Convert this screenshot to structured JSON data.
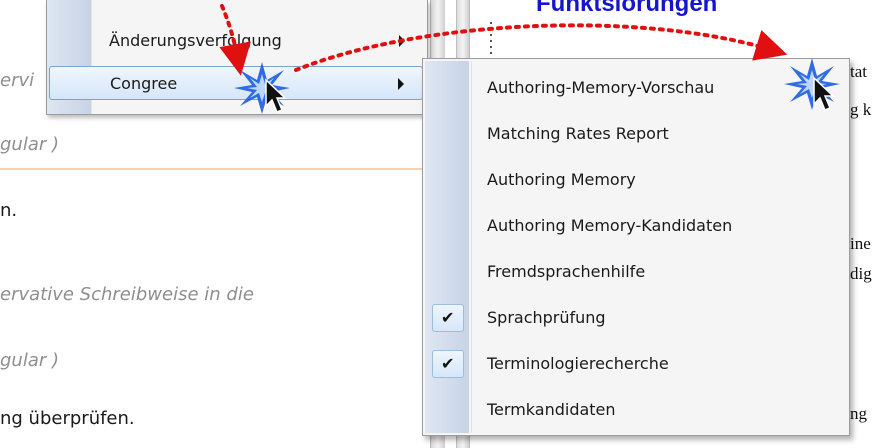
{
  "background_left": {
    "lines": [
      {
        "text": "ervi",
        "italic": true
      },
      {
        "text": "gular )",
        "italic": true
      },
      {
        "text": "n.",
        "italic": false
      },
      {
        "text": "ervative Schreibweise in die",
        "italic": true
      },
      {
        "text": "gular )",
        "italic": true
      },
      {
        "text": "ng überprüfen.",
        "italic": false
      }
    ]
  },
  "background_right": {
    "title": "Funktsiorungen",
    "fragments": [
      "tat",
      "g k",
      "ine",
      "dig",
      "ng"
    ]
  },
  "context_menu": {
    "items": [
      {
        "label": "Änderungsverfolgung",
        "has_submenu": true,
        "highlighted": false
      },
      {
        "label": "Congree",
        "has_submenu": true,
        "highlighted": true
      }
    ]
  },
  "submenu": {
    "items": [
      {
        "label": "Authoring-Memory-Vorschau",
        "checked": false
      },
      {
        "label": "Matching Rates Report",
        "checked": false
      },
      {
        "label": "Authoring Memory",
        "checked": false
      },
      {
        "label": "Authoring Memory-Kandidaten",
        "checked": false
      },
      {
        "label": "Fremdsprachenhilfe",
        "checked": false
      },
      {
        "label": "Sprachprüfung",
        "checked": true
      },
      {
        "label": "Terminologierecherche",
        "checked": true
      },
      {
        "label": "Termkandidaten",
        "checked": false
      }
    ],
    "check_glyph": "✔"
  },
  "colors": {
    "annotation_dots": "#e01010",
    "starburst": "#1f5fe0",
    "title_blue": "#1515cc",
    "highlight_border": "#7da2ce"
  }
}
